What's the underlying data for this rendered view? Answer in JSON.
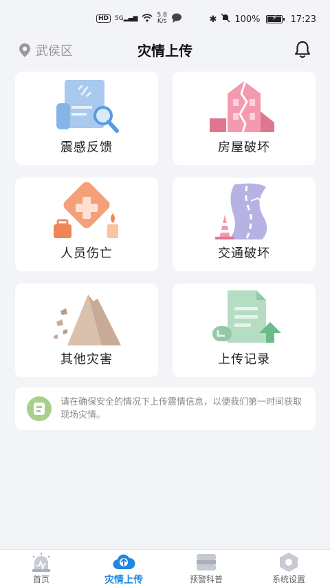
{
  "status_bar": {
    "hd": "HD",
    "signal_label": "5G",
    "net_speed_value": "5.8",
    "net_speed_unit": "K/s",
    "battery": "100%",
    "time": "17:23"
  },
  "header": {
    "location": "武侯区",
    "title": "灾情上传"
  },
  "cards": [
    {
      "label": "震感反馈",
      "icon": "report-search-icon"
    },
    {
      "label": "房屋破坏",
      "icon": "cracked-building-icon"
    },
    {
      "label": "人员伤亡",
      "icon": "first-aid-icon"
    },
    {
      "label": "交通破坏",
      "icon": "cracked-road-icon"
    },
    {
      "label": "其他灾害",
      "icon": "landslide-icon"
    },
    {
      "label": "上传记录",
      "icon": "upload-document-icon"
    }
  ],
  "notice": {
    "text": "请在确保安全的情况下上传震情信息，以便我们第一时间获取现场灾情。"
  },
  "tabbar": {
    "items": [
      {
        "label": "首页",
        "icon": "alarm-icon",
        "active": false
      },
      {
        "label": "灾情上传",
        "icon": "cloud-upload-icon",
        "active": true
      },
      {
        "label": "预警科普",
        "icon": "book-icon",
        "active": false
      },
      {
        "label": "系统设置",
        "icon": "settings-icon",
        "active": false
      }
    ]
  },
  "colors": {
    "accent": "#1e87e5",
    "background": "#f3f4f8"
  }
}
